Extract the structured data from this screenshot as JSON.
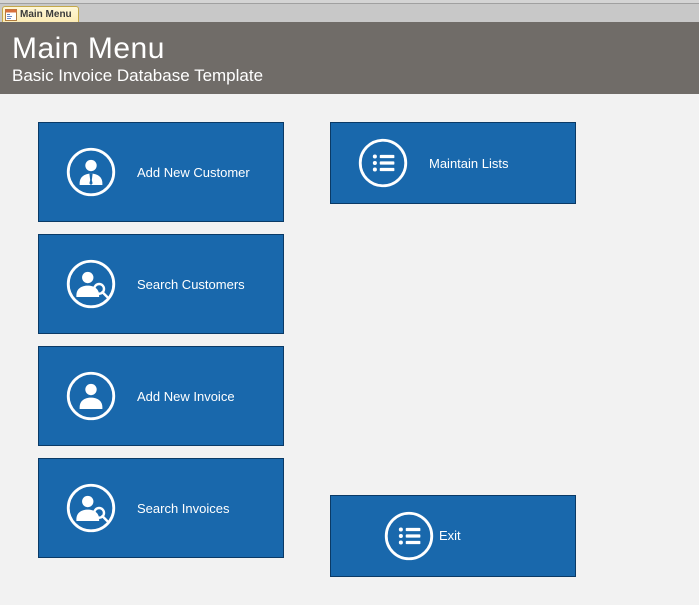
{
  "tab": {
    "label": "Main Menu"
  },
  "header": {
    "title": "Main Menu",
    "subtitle": "Basic Invoice Database Template"
  },
  "tiles": {
    "add_customer": "Add New Customer",
    "search_customers": "Search Customers",
    "add_invoice": "Add New Invoice",
    "search_invoices": "Search Invoices",
    "maintain_lists": "Maintain Lists",
    "exit": "Exit"
  }
}
